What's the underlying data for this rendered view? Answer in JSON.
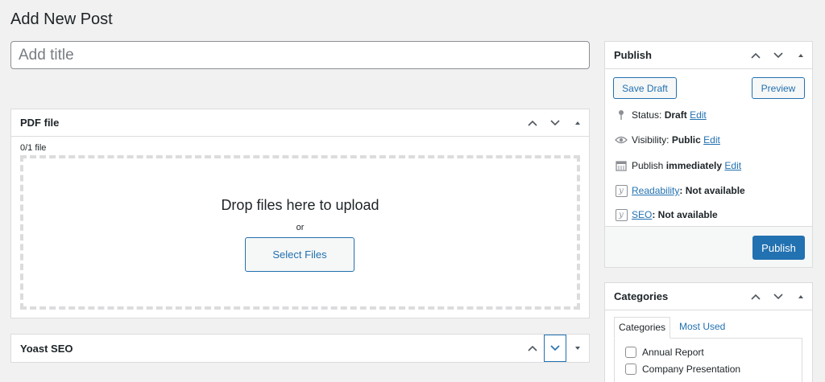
{
  "page": {
    "title": "Add New Post"
  },
  "title_input": {
    "placeholder": "Add title",
    "value": ""
  },
  "pdf_box": {
    "title": "PDF file",
    "count": "0/1 file",
    "drop_text": "Drop files here to upload",
    "or_text": "or",
    "select_button": "Select Files"
  },
  "yoast_box": {
    "title": "Yoast SEO"
  },
  "publish_box": {
    "title": "Publish",
    "save_draft": "Save Draft",
    "preview": "Preview",
    "status_label": "Status:",
    "status_value": "Draft",
    "visibility_label": "Visibility:",
    "visibility_value": "Public",
    "publish_label": "Publish",
    "publish_value": "immediately",
    "edit": "Edit",
    "readability_link": "Readability",
    "readability_value": ": Not available",
    "seo_link": "SEO",
    "seo_value": ": Not available",
    "publish_button": "Publish"
  },
  "categories_box": {
    "title": "Categories",
    "tabs": [
      "Categories",
      "Most Used"
    ],
    "items": [
      "Annual Report",
      "Company Presentation"
    ]
  },
  "colors": {
    "accent": "#2271b1",
    "border": "#dcdcde",
    "background": "#f1f1f1"
  },
  "icons": {
    "up": "chevron-up-icon",
    "down": "chevron-down-icon",
    "toggle": "triangle-toggle-icon",
    "pin": "pin-icon",
    "eye": "eye-icon",
    "calendar": "calendar-icon",
    "yoast": "yoast-icon"
  }
}
